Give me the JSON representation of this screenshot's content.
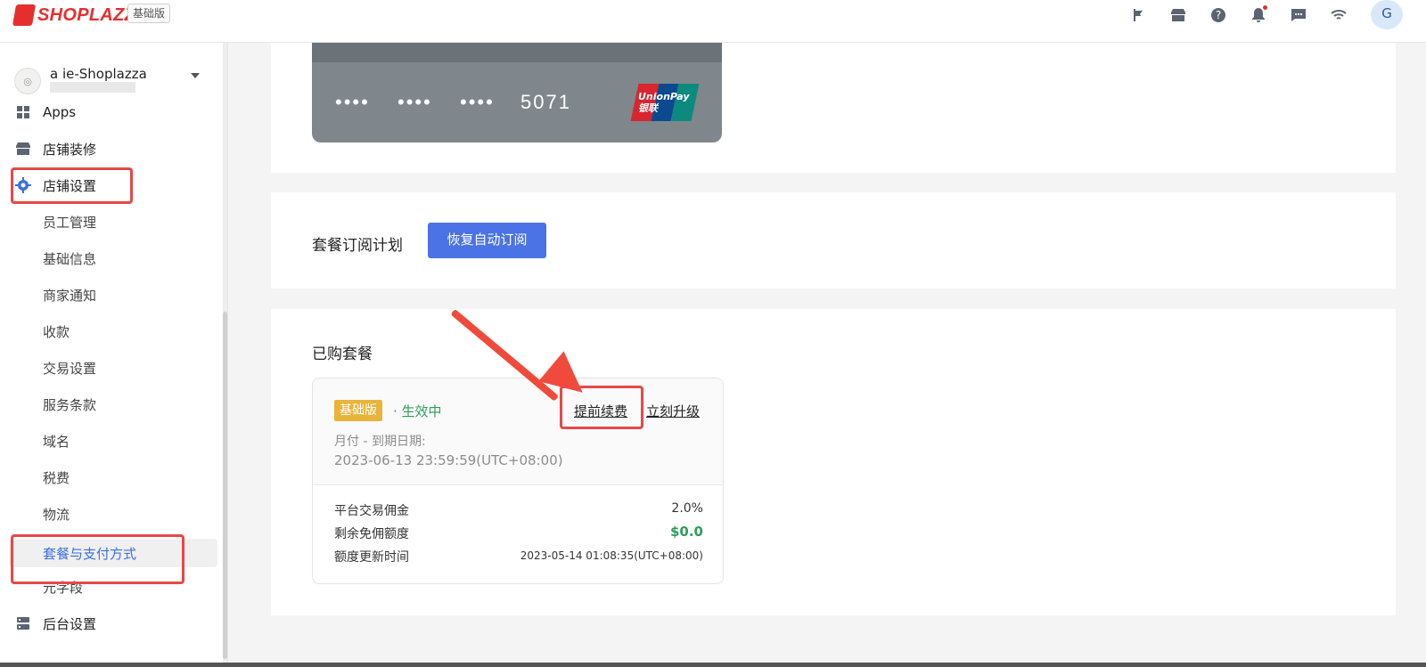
{
  "header": {
    "brand": "SHOPLAZZA",
    "plan_tag": "基础版",
    "avatar_letter": "G",
    "icons": [
      "flag-icon",
      "store-icon",
      "help-icon",
      "bell-icon",
      "message-icon",
      "wifi-icon"
    ]
  },
  "sidebar": {
    "store_name": "a  ie-Shoplazza",
    "items": [
      {
        "label": "Apps",
        "icon": "apps-icon"
      },
      {
        "label": "店铺装修",
        "icon": "store-icon"
      },
      {
        "label": "店铺设置",
        "icon": "gear-icon"
      },
      {
        "label": "员工管理"
      },
      {
        "label": "基础信息"
      },
      {
        "label": "商家通知"
      },
      {
        "label": "收款"
      },
      {
        "label": "交易设置"
      },
      {
        "label": "服务条款"
      },
      {
        "label": "域名"
      },
      {
        "label": "税费"
      },
      {
        "label": "物流"
      },
      {
        "label": "套餐与支付方式",
        "active": true
      },
      {
        "label": "元字段"
      },
      {
        "label": "后台设置",
        "icon": "server-icon"
      }
    ]
  },
  "payment_card": {
    "masked_groups": [
      "••••",
      "••••",
      "••••"
    ],
    "last4": "5071",
    "brand": "UnionPay",
    "brand_cn": "银联"
  },
  "subscription": {
    "title": "套餐订阅计划",
    "resume_button": "恢复自动订阅"
  },
  "purchased": {
    "title": "已购套餐",
    "plan_badge": "基础版",
    "status": "· 生效中",
    "renew_link": "提前续费",
    "upgrade_link": "立刻升级",
    "billing_label": "月付 - 到期日期:",
    "expiry": "2023-06-13 23:59:59(UTC+08:00)",
    "rows": [
      {
        "label": "平台交易佣金",
        "value": "2.0%"
      },
      {
        "label": "剩余免佣额度",
        "value": "$0.0"
      },
      {
        "label": "额度更新时间",
        "value": "2023-05-14 01:08:35(UTC+08:00)"
      }
    ]
  },
  "colors": {
    "brand": "#e62e2e",
    "primary": "#4b73e6",
    "active": "#2e9e5b",
    "badge": "#e8b43a",
    "annotation": "#e84848"
  }
}
